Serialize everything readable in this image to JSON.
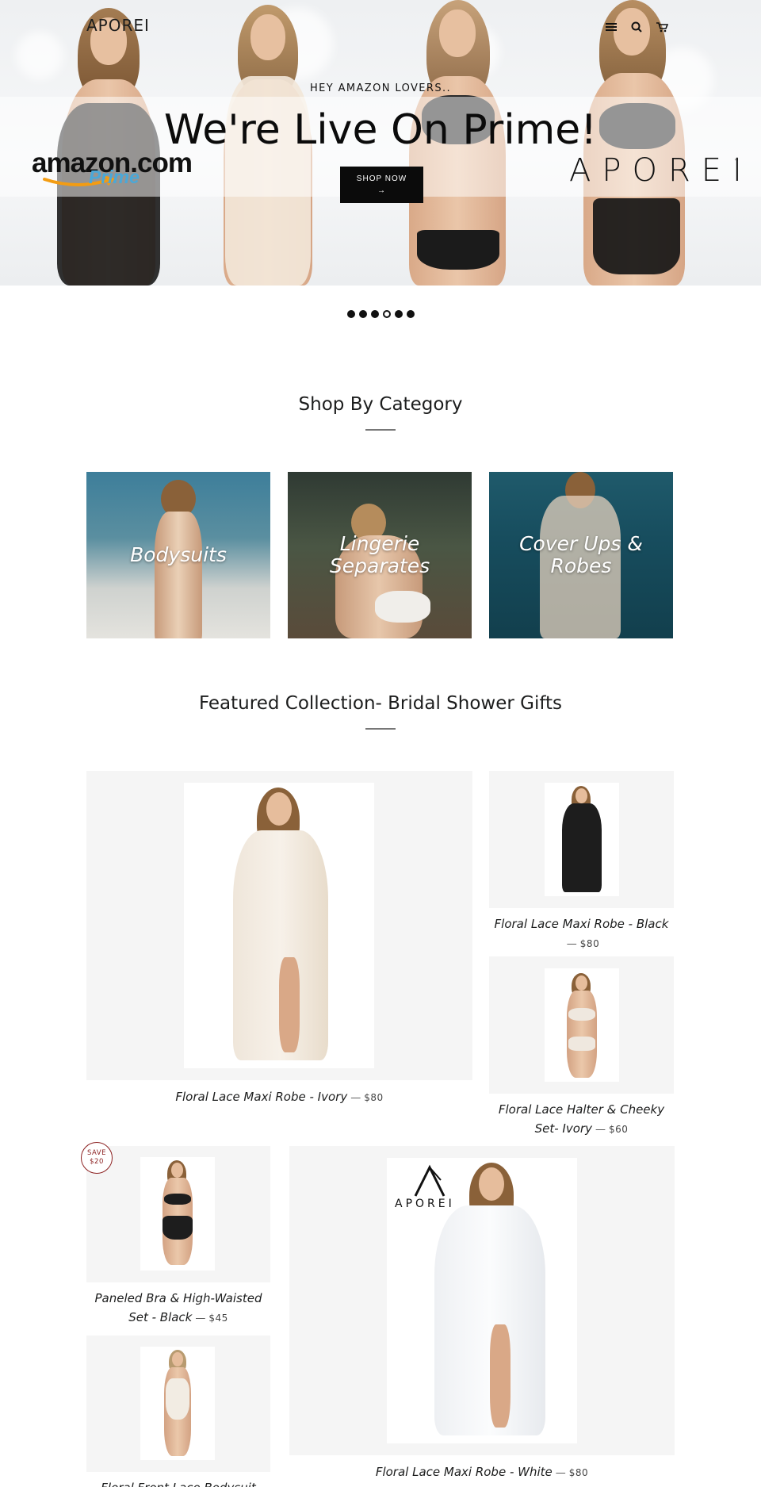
{
  "header": {
    "logo_text": "APOREI",
    "icons": [
      "menu-icon",
      "search-icon",
      "cart-icon"
    ]
  },
  "hero": {
    "eyebrow": "HEY AMAZON LOVERS..",
    "title": "We're Live On Prime!",
    "button_label": "SHOP NOW",
    "button_arrow": "→",
    "amazon_word": "amazon.com",
    "amazon_prime": "Prime",
    "brand_mark": "APOREI",
    "brand_tm": "™",
    "slides_count": 6,
    "active_slide": 4
  },
  "categories": {
    "title": "Shop By Category",
    "items": [
      {
        "label": "Bodysuits"
      },
      {
        "label": "Lingerie Separates"
      },
      {
        "label": "Cover Ups & Robes"
      }
    ]
  },
  "featured": {
    "title": "Featured Collection- Bridal Shower Gifts",
    "products": [
      {
        "name": "Floral Lace Maxi Robe - Ivory",
        "price": "$80"
      },
      {
        "name": "Floral Lace Maxi Robe - Black",
        "price": "$80"
      },
      {
        "name": "Floral Lace Halter & Cheeky Set- Ivory",
        "price": "$60"
      },
      {
        "name": "Paneled Bra & High-Waisted Set - Black",
        "price": "$45",
        "badge_line1": "SAVE",
        "badge_line2": "$20"
      },
      {
        "name": "Floral Lace Maxi Robe - White",
        "price": "$80",
        "logo_text": "APOREI"
      },
      {
        "name": "Floral Front Lace Bodysuit",
        "price": ""
      }
    ],
    "separator": "—"
  },
  "colors": {
    "text": "#1c1d1d",
    "button_bg": "#0b0b0b",
    "badge": "#8b1f1f",
    "product_bg": "#f5f5f5",
    "prime_blue": "#4aa8d8"
  }
}
